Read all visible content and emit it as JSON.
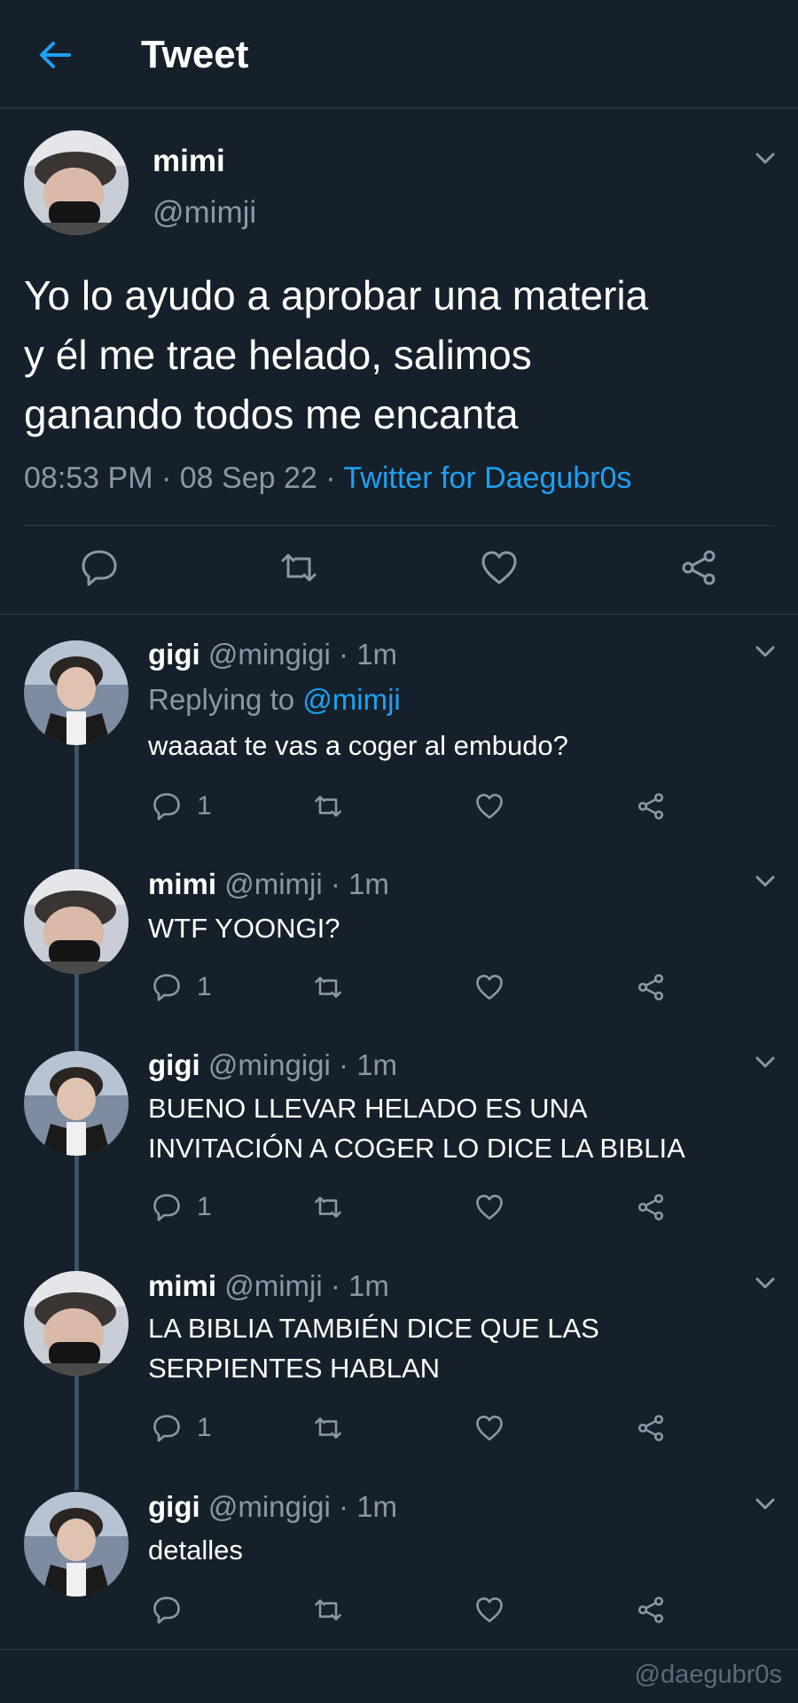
{
  "header": {
    "title": "Tweet"
  },
  "main_tweet": {
    "name": "mimi",
    "handle": "@mimji",
    "text": "Yo lo ayudo a aprobar una materia\ny él me trae helado, salimos\nganando todos me encanta",
    "time": "08:53 PM",
    "date": "08 Sep 22",
    "source": "Twitter for Daegubr0s",
    "sep": " · "
  },
  "replies": [
    {
      "name": "gigi",
      "handle": "@mingigi",
      "time": "1m",
      "replying_prefix": "Replying to ",
      "replying_handle": "@mimji",
      "text": "waaaat te vas a coger al embudo?",
      "reply_count": "1"
    },
    {
      "name": "mimi",
      "handle": "@mimji",
      "time": "1m",
      "text": "WTF YOONGI?",
      "reply_count": "1"
    },
    {
      "name": "gigi",
      "handle": "@mingigi",
      "time": "1m",
      "text": "BUENO LLEVAR HELADO ES UNA\nINVITACIÓN A COGER LO DICE LA BIBLIA",
      "reply_count": "1"
    },
    {
      "name": "mimi",
      "handle": "@mimji",
      "time": "1m",
      "text": "LA BIBLIA TAMBIÉN DICE QUE LAS\nSERPIENTES HABLAN",
      "reply_count": "1"
    },
    {
      "name": "gigi",
      "handle": "@mingigi",
      "time": "1m",
      "text": "detalles",
      "reply_count": ""
    }
  ],
  "separator": " · ",
  "watermark": "@daegubr0s",
  "colors": {
    "background": "#15202b",
    "accent": "#1da1f2",
    "muted": "#8899a6",
    "divider": "#2f3e4d"
  },
  "icons": [
    "back-arrow-icon",
    "chevron-down-icon",
    "reply-icon",
    "retweet-icon",
    "like-icon",
    "share-icon"
  ]
}
